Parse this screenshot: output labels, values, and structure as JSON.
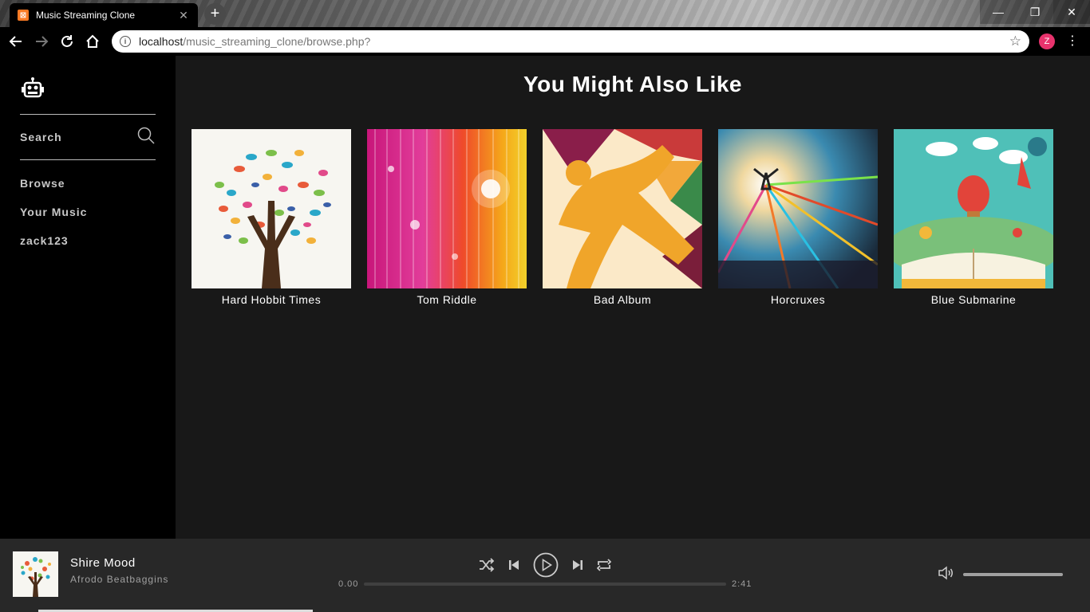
{
  "browser": {
    "tab_title": "Music Streaming Clone",
    "tab_favicon": "xampp-icon",
    "url_host": "localhost",
    "url_path": "/music_streaming_clone/browse.php?",
    "profile_initial": "Z"
  },
  "sidebar": {
    "logo": "robot-icon",
    "search_label": "Search",
    "items": [
      {
        "label": "Browse"
      },
      {
        "label": "Your Music"
      },
      {
        "label": "zack123"
      }
    ]
  },
  "main": {
    "title": "You Might Also Like",
    "albums": [
      {
        "title": "Hard Hobbit Times"
      },
      {
        "title": "Tom Riddle"
      },
      {
        "title": "Bad Album"
      },
      {
        "title": "Horcruxes"
      },
      {
        "title": "Blue Submarine"
      }
    ]
  },
  "player": {
    "track": "Shire Mood",
    "artist": "Afrodo Beatbaggins",
    "current_time": "0.00",
    "total_time": "2:41",
    "progress": 0,
    "volume": 1.0
  },
  "colors": {
    "sidebar_bg": "#000000",
    "main_bg": "#181818",
    "player_bg": "#282828",
    "text": "#ffffff",
    "muted_text": "#a0a0a0"
  }
}
